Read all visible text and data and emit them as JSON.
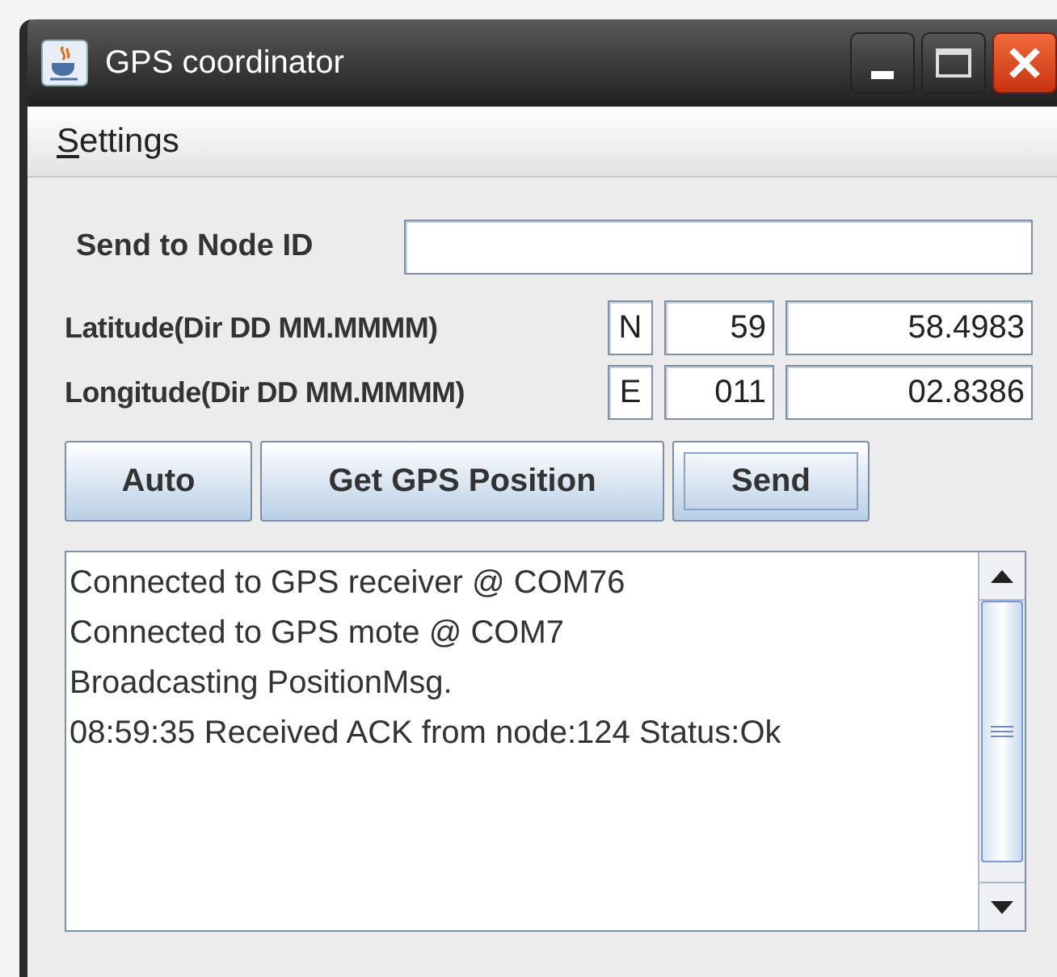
{
  "window": {
    "title": "GPS coordinator"
  },
  "menu": [
    {
      "label": "Settings",
      "mnemonic_underlined": true
    }
  ],
  "node_id": {
    "label": "Send to Node ID"
  },
  "coordinates": [
    {
      "label": "Latitude(Dir DD MM.MMMM)",
      "dir": "N",
      "degrees": "59",
      "minutes": "58.4983"
    },
    {
      "label": "Longitude(Dir DD MM.MMMM)",
      "dir": "E",
      "degrees": "011",
      "minutes": "02.8386"
    }
  ],
  "buttons": [
    {
      "label": "Auto",
      "focused": false
    },
    {
      "label": "Get GPS Position",
      "focused": false
    },
    {
      "label": "Send",
      "focused": true
    }
  ],
  "log": [
    "Connected to GPS receiver @ COM76",
    "Connected to GPS mote @ COM7",
    "Broadcasting PositionMsg.",
    "08:59:35 Received ACK from node:124 Status:Ok"
  ]
}
